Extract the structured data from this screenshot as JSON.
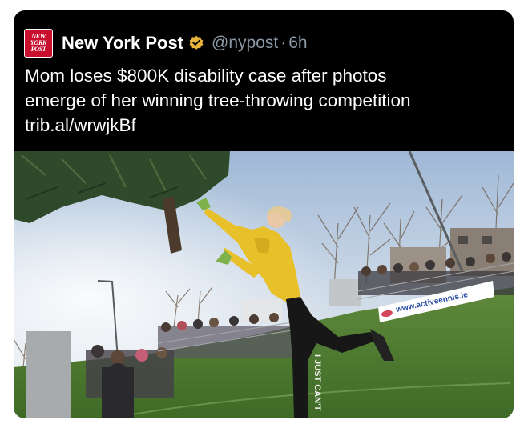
{
  "account": {
    "name": "New York Post",
    "handle": "@nypost",
    "separator": "·",
    "time": "6h",
    "avatar_lines": [
      "NEW",
      "YORK",
      "POST"
    ],
    "avatar_color": "#c8102e",
    "verified_icon": "verified-badge-icon",
    "verified_color": "#e8b33a"
  },
  "tweet": {
    "lines": [
      "Mom loses $800K disability case after photos",
      "emerge of her winning tree-throwing competition",
      "trib.al/wrwjkBf"
    ]
  },
  "photo": {
    "banner_text": "www.activeennis.ie",
    "leggings_text": "I JUST CAN'T"
  }
}
